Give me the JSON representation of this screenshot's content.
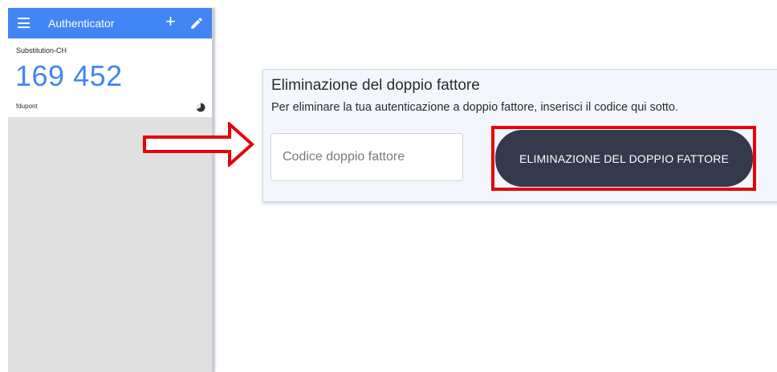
{
  "app": {
    "title": "Authenticator",
    "toolbar": {
      "add_icon": "plus-icon",
      "edit_icon": "pencil-icon",
      "menu_icon": "hamburger-menu-icon"
    },
    "accounts": [
      {
        "issuer": "Substitution-CH",
        "code": "169 452",
        "account": "fdupont",
        "timer_icon": "countdown-pie-icon"
      }
    ],
    "accent_color": "#4285f4"
  },
  "annotation": {
    "arrow_icon": "right-arrow-outline-icon",
    "color": "#e8000b"
  },
  "panel": {
    "heading": "Eliminazione del doppio fattore",
    "description": "Per eliminare la tua autenticazione a doppio fattore, inserisci il codice qui sotto.",
    "input": {
      "value": "",
      "placeholder": "Codice doppio fattore"
    },
    "button_label": "ELIMINAZIONE DEL DOPPIO FATTORE",
    "button_color": "#343a4b"
  }
}
